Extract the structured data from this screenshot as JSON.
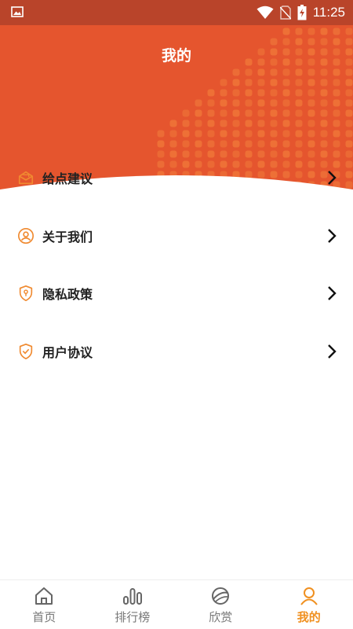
{
  "status_bar": {
    "time": "11:25"
  },
  "header": {
    "title": "我的"
  },
  "menu": {
    "items": [
      {
        "label": "给点建议",
        "icon": "feedback-icon"
      },
      {
        "label": "关于我们",
        "icon": "about-icon"
      },
      {
        "label": "隐私政策",
        "icon": "privacy-shield-icon"
      },
      {
        "label": "用户协议",
        "icon": "agreement-shield-icon"
      }
    ]
  },
  "tabbar": {
    "tabs": [
      {
        "label": "首页",
        "icon": "home-icon",
        "active": false
      },
      {
        "label": "排行榜",
        "icon": "ranking-icon",
        "active": false
      },
      {
        "label": "欣赏",
        "icon": "planet-icon",
        "active": false
      },
      {
        "label": "我的",
        "icon": "profile-icon",
        "active": true
      }
    ]
  },
  "colors": {
    "header": "#e5552e",
    "status_bar": "#b9442a",
    "accent": "#f09020"
  }
}
